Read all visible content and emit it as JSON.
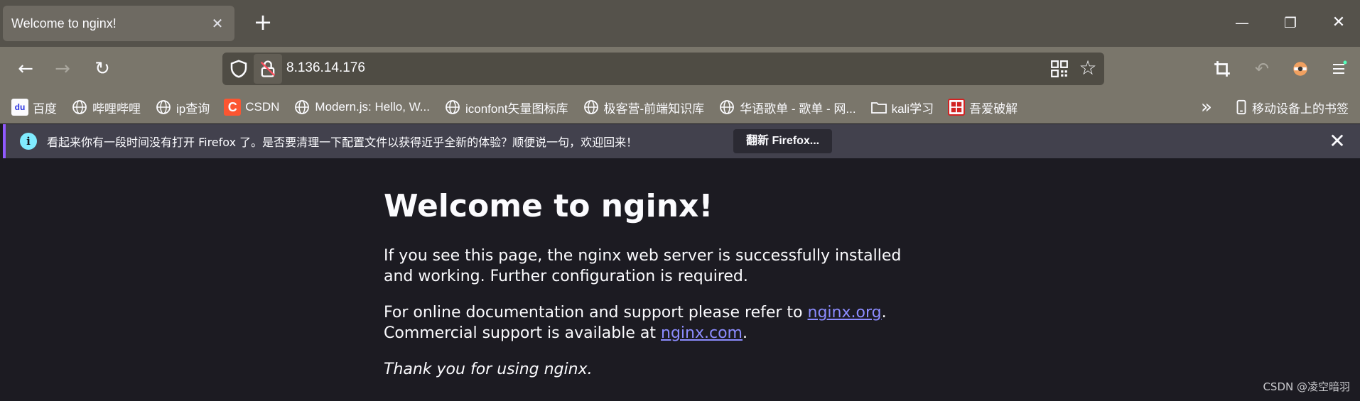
{
  "tabs": [
    {
      "title": "Welcome to nginx!",
      "close": "✕"
    }
  ],
  "new_tab_label": "+",
  "window_controls": {
    "minimize": "—",
    "restore": "❐",
    "close": "✕"
  },
  "nav": {
    "back": "←",
    "forward": "→",
    "reload": "↻",
    "url": "8.136.14.176"
  },
  "toolbar_icons": [
    "crop-icon",
    "undo-icon",
    "extension-icon",
    "menu-icon"
  ],
  "bookmarks": [
    {
      "label": "百度",
      "icon": "baidu-icon"
    },
    {
      "label": "哔哩哔哩",
      "icon": "globe-icon"
    },
    {
      "label": "ip查询",
      "icon": "globe-icon"
    },
    {
      "label": "CSDN",
      "icon": "csdn-icon",
      "icon_text": "C"
    },
    {
      "label": "Modern.js: Hello, W...",
      "icon": "globe-icon"
    },
    {
      "label": "iconfont矢量图标库",
      "icon": "globe-icon"
    },
    {
      "label": "极客营-前端知识库",
      "icon": "globe-icon"
    },
    {
      "label": "华语歌单 - 歌单 - 网...",
      "icon": "globe-icon"
    },
    {
      "label": "kali学习",
      "icon": "folder-icon"
    },
    {
      "label": "吾爱破解",
      "icon": "52pojie-icon"
    }
  ],
  "bookmarks_overflow": "»",
  "mobile_bookmarks": "移动设备上的书签",
  "notification": {
    "icon_text": "i",
    "text": "看起来你有一段时间没有打开 Firefox 了。是否要清理一下配置文件以获得近乎全新的体验？顺便说一句，欢迎回来！",
    "button": "翻新 Firefox...",
    "close": "✕"
  },
  "page": {
    "title": "Welcome to nginx!",
    "p1": "If you see this page, the nginx web server is successfully installed and working. Further configuration is required.",
    "p2_prefix": "For online documentation and support please refer to ",
    "link_org": "nginx.org",
    "p2_mid": ".",
    "p2_line2": "Commercial support is available at ",
    "link_com": "nginx.com",
    "p2_end": ".",
    "thanks": "Thank you for using nginx."
  },
  "watermark": "CSDN @凌空暗羽",
  "colors": {
    "tabstrip": "#55524b",
    "toolbar": "#7a766b",
    "content_bg": "#1c1b22",
    "link": "#8c8cff",
    "notification_accent": "#9059ff"
  }
}
